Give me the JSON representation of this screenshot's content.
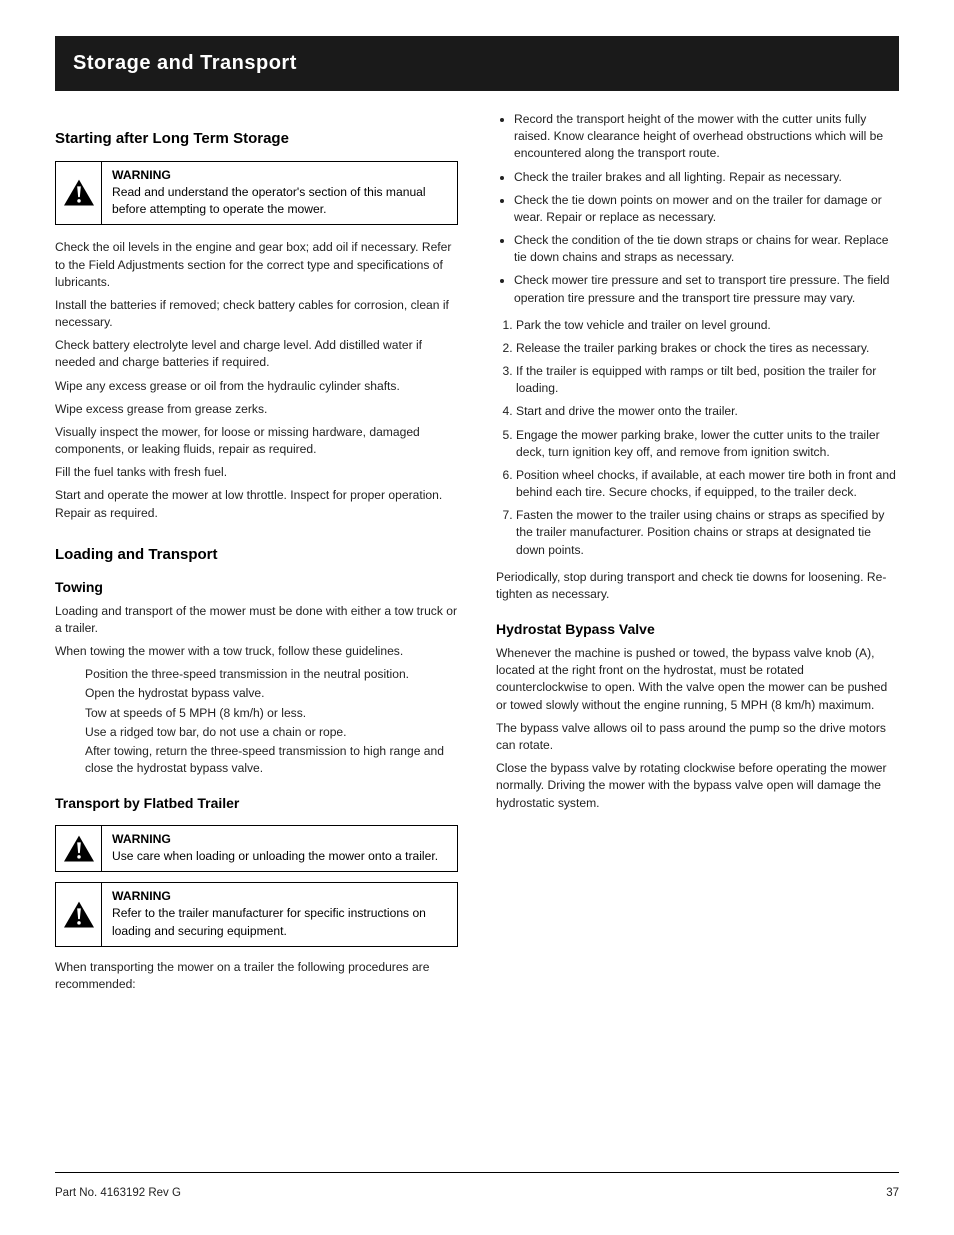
{
  "titleBar": "Storage and Transport",
  "col1": {
    "section1_head": "Starting after Long Term Storage",
    "warn1_title": "WARNING",
    "warn1_body": "Read and understand the operator's section of this manual before attempting to operate the mower.",
    "p1": "Check the oil levels in the engine and gear box; add oil if necessary. Refer to the Field Adjustments section for the correct type and specifications of lubricants.",
    "p2": "Install the batteries if removed; check battery cables for corrosion, clean if necessary.",
    "p3": "Check battery electrolyte level and charge level. Add distilled water if needed and charge batteries if required.",
    "p4": "Wipe any excess grease or oil from the hydraulic cylinder shafts.",
    "p5": "Wipe excess grease from grease zerks.",
    "p6": "Visually inspect the mower, for loose or missing hardware, damaged components, or leaking fluids, repair as required.",
    "p7": "Fill the fuel tanks with fresh fuel.",
    "p8": "Start and operate the mower at low throttle. Inspect for proper operation. Repair as required.",
    "section2_head": "Loading and Transport",
    "section2_sub": "Towing",
    "p9": "Loading and transport of the mower must be done with either a tow truck or a trailer.",
    "p10": "When towing the mower with a tow truck, follow these guidelines.",
    "li1": "Position the three-speed transmission in the neutral position.",
    "li2": "Open the hydrostat bypass valve.",
    "li3": "Tow at speeds of 5 MPH (8 km/h) or less.",
    "li4": "Use a ridged tow bar, do not use a chain or rope.",
    "li5": "After towing, return the three-speed transmission to high range and close the hydrostat bypass valve.",
    "section3_sub": "Transport by Flatbed Trailer",
    "warn2_title": "WARNING",
    "warn2_body": "Use care when loading or unloading the mower onto a trailer.",
    "warn3_title": "WARNING",
    "warn3_body": "Refer to the trailer manufacturer for specific instructions on loading and securing equipment.",
    "p11": "When transporting the mower on a trailer the following procedures are recommended:"
  },
  "col2": {
    "bul1": "Record the transport height of the mower with the cutter units fully raised. Know clearance height of overhead obstructions which will be encountered along the transport route.",
    "bul2": "Check the trailer brakes and all lighting. Repair as necessary.",
    "bul3": "Check the tie down points on mower and on the trailer for damage or wear. Repair or replace as necessary.",
    "bul4": "Check the condition of the tie down straps or chains for wear. Replace tie down chains and straps as necessary.",
    "bul5": "Check mower tire pressure and set to transport tire pressure. The field operation tire pressure and the transport tire pressure may vary.",
    "n1": "Park the tow vehicle and trailer on level ground.",
    "n2": "Release the trailer parking brakes or chock the tires as necessary.",
    "n3": "If the trailer is equipped with ramps or tilt bed, position the trailer for loading.",
    "n4": "Start and drive the mower onto the trailer.",
    "n5": "Engage the mower parking brake, lower the cutter units to the trailer deck, turn ignition key off, and remove from ignition switch.",
    "n6": "Position wheel chocks, if available, at each mower tire both in front and behind each tire. Secure chocks, if equipped, to the trailer deck.",
    "n7": "Fasten the mower to the trailer using chains or straps as specified by the trailer manufacturer. Position chains or straps at designated tie down points.",
    "p_after": "Periodically, stop during transport and check tie downs for loosening. Re-tighten as necessary.",
    "section4_sub": "Hydrostat Bypass Valve",
    "p12": "Whenever the machine is pushed or towed, the bypass valve knob (A), located at the right front on the hydrostat, must be rotated counterclockwise to open. With the valve open the mower can be pushed or towed slowly without the engine running, 5 MPH (8 km/h) maximum.",
    "p13": "The bypass valve allows oil to pass around the pump so the drive motors can rotate.",
    "p14": "Close the bypass valve by rotating clockwise before operating the mower normally. Driving the mower with the bypass valve open will damage the hydrostatic system."
  },
  "footer": {
    "left": "Part No. 4163192 Rev G",
    "right": "37"
  }
}
